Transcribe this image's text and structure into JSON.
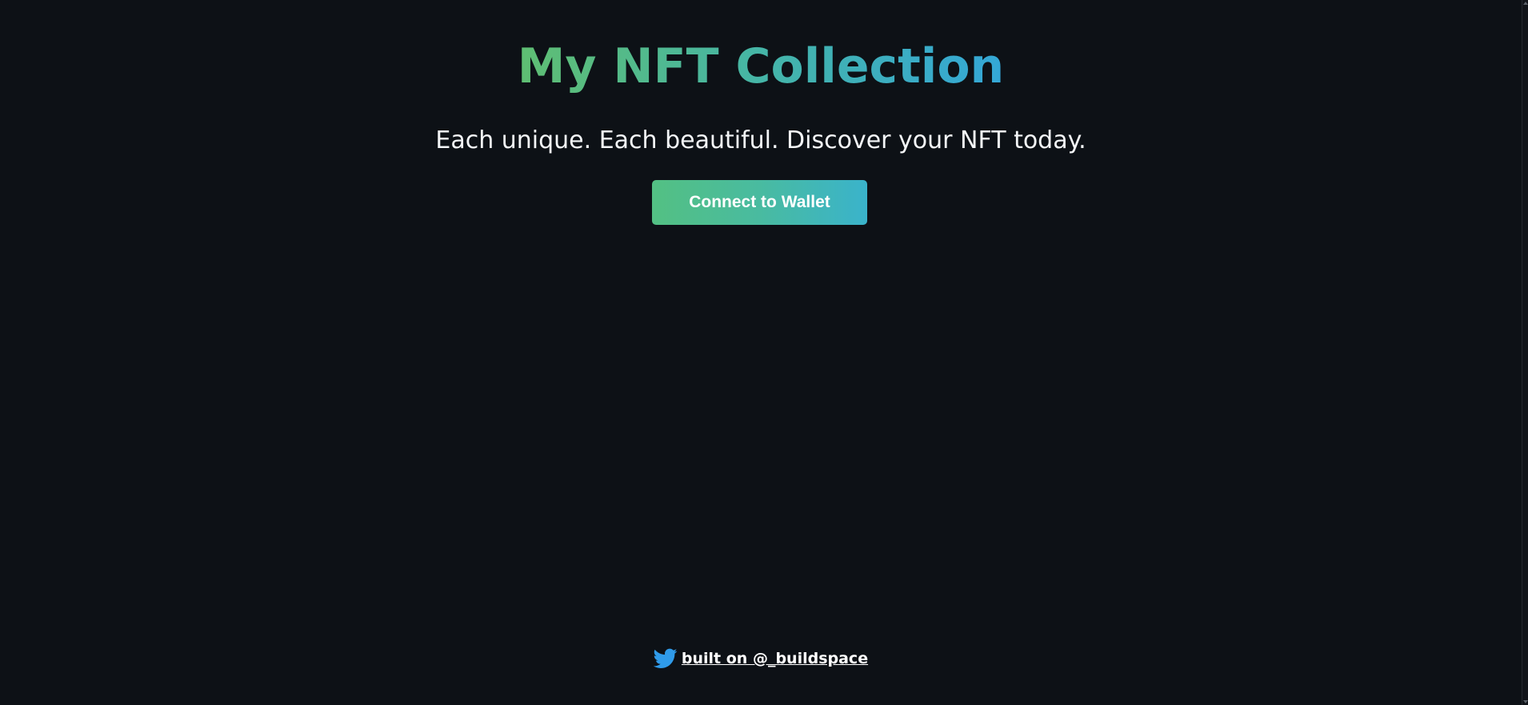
{
  "header": {
    "title": "My NFT Collection",
    "subtitle": "Each unique. Each beautiful. Discover your NFT today."
  },
  "actions": {
    "connect_wallet_label": "Connect to Wallet"
  },
  "footer": {
    "icon": "twitter-icon",
    "link_text": "built on @_buildspace"
  },
  "colors": {
    "background": "#0d1116",
    "title_gradient_start": "#5fbe72",
    "title_gradient_end": "#34a7d7",
    "button_gradient_start": "#53c083",
    "button_gradient_end": "#3ab3cb",
    "twitter_blue": "#2f9bea"
  }
}
